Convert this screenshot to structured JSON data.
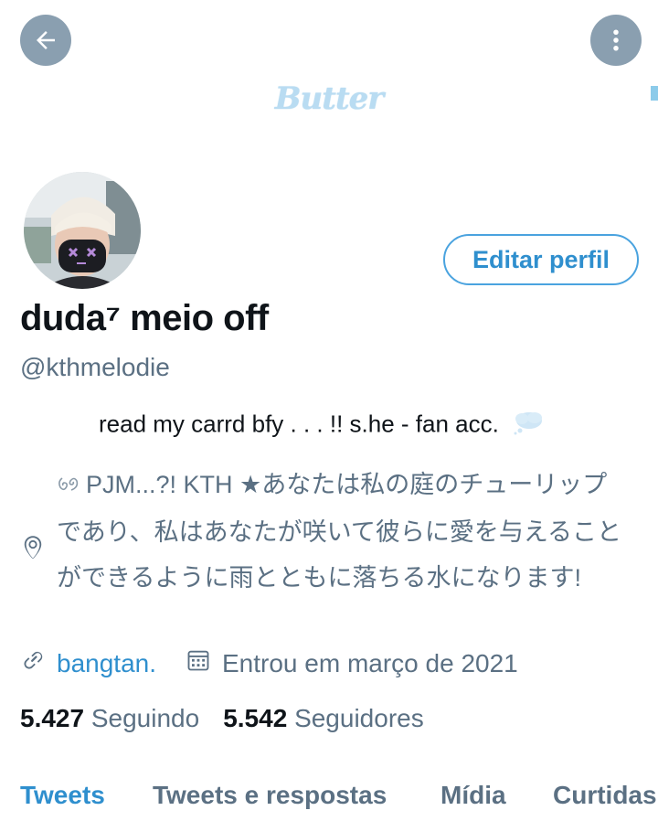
{
  "header": {
    "banner_title": "Butter",
    "back_icon": "arrow-left-icon",
    "more_icon": "more-vertical-icon"
  },
  "profile": {
    "display_name": "duda⁷ meio off",
    "handle": "@kthmelodie",
    "edit_button": "Editar perfil",
    "bio": "read my carrd bfy . . . !! s.he - fan acc.",
    "location": "PJM...?! KTH ★あなたは私の庭のチューリップであり、私はあなたが咲いて彼らに愛を与えることができるように雨とともに落ちる水になります!",
    "website": "bangtan.",
    "joined": "Entrou em março de 2021",
    "following_count": "5.427",
    "following_label": "Seguindo",
    "followers_count": "5.542",
    "followers_label": "Seguidores"
  },
  "tabs": [
    {
      "label": "Tweets",
      "active": true
    },
    {
      "label": "Tweets e respostas",
      "active": false
    },
    {
      "label": "Mídia",
      "active": false
    },
    {
      "label": "Curtidas",
      "active": false
    }
  ],
  "colors": {
    "accent": "#2f8fce",
    "secondary_text": "#5b7083",
    "icon_button_bg": "#8a9fb0",
    "banner_text": "#b9dcf2"
  }
}
